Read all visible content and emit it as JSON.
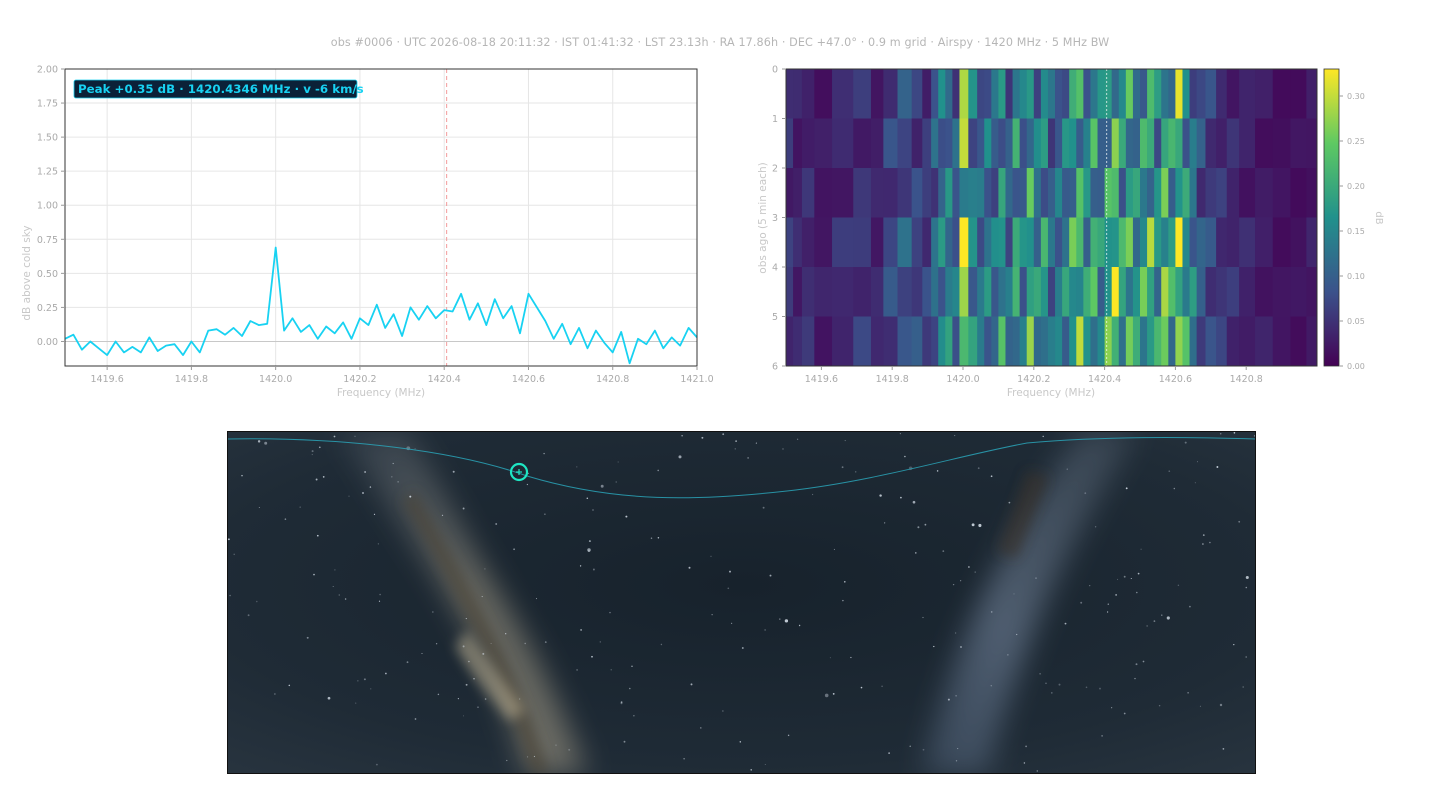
{
  "header": {
    "text": "obs #0006  ·  UTC 2026-08-18 20:11:32  ·  IST 01:41:32  ·  LST 23.13h  ·  RA 17.86h  ·  DEC +47.0°  ·  0.9 m grid · Airspy · 1420 MHz · 5 MHz BW"
  },
  "spectrum": {
    "annotation": "Peak +0.35 dB · 1420.4346 MHz · v -6 km/s"
  },
  "chart_data": [
    {
      "type": "line",
      "xlabel": "Frequency (MHz)",
      "ylabel": "dB above cold sky",
      "xlim": [
        1419.5,
        1421.0
      ],
      "ylim": [
        -0.18,
        2.0
      ],
      "xticks": [
        1419.6,
        1419.8,
        1420.0,
        1420.2,
        1420.4,
        1420.6,
        1420.8,
        1421.0
      ],
      "yticks": [
        0.0,
        0.25,
        0.5,
        0.75,
        1.0,
        1.25,
        1.5,
        1.75,
        2.0
      ],
      "grid": true,
      "reference_line_x": 1420.4058,
      "line_color": "#18d2f2",
      "series": [
        {
          "x": [
            1419.5,
            1419.52,
            1419.54,
            1419.56,
            1419.58,
            1419.6,
            1419.62,
            1419.64,
            1419.66,
            1419.68,
            1419.7,
            1419.72,
            1419.74,
            1419.76,
            1419.78,
            1419.8,
            1419.82,
            1419.84,
            1419.86,
            1419.88,
            1419.9,
            1419.92,
            1419.94,
            1419.96,
            1419.98,
            1420.0,
            1420.02,
            1420.04,
            1420.06,
            1420.08,
            1420.1,
            1420.12,
            1420.14,
            1420.16,
            1420.18,
            1420.2,
            1420.22,
            1420.24,
            1420.26,
            1420.28,
            1420.3,
            1420.32,
            1420.34,
            1420.36,
            1420.38,
            1420.4,
            1420.42,
            1420.44,
            1420.46,
            1420.48,
            1420.5,
            1420.52,
            1420.54,
            1420.56,
            1420.58,
            1420.6,
            1420.62,
            1420.64,
            1420.66,
            1420.68,
            1420.7,
            1420.72,
            1420.74,
            1420.76,
            1420.78,
            1420.8,
            1420.82,
            1420.84,
            1420.86,
            1420.88,
            1420.9,
            1420.92,
            1420.94,
            1420.96,
            1420.98,
            1421.0
          ],
          "values": [
            0.02,
            0.05,
            -0.06,
            0.0,
            -0.05,
            -0.1,
            0.0,
            -0.08,
            -0.04,
            -0.08,
            0.03,
            -0.07,
            -0.03,
            -0.02,
            -0.1,
            0.0,
            -0.08,
            0.08,
            0.09,
            0.05,
            0.1,
            0.04,
            0.15,
            0.12,
            0.13,
            0.69,
            0.08,
            0.17,
            0.07,
            0.12,
            0.02,
            0.11,
            0.06,
            0.14,
            0.02,
            0.17,
            0.12,
            0.27,
            0.1,
            0.2,
            0.04,
            0.25,
            0.16,
            0.26,
            0.17,
            0.23,
            0.22,
            0.35,
            0.16,
            0.28,
            0.12,
            0.31,
            0.17,
            0.26,
            0.06,
            0.35,
            0.25,
            0.15,
            0.02,
            0.13,
            -0.02,
            0.1,
            -0.05,
            0.08,
            -0.01,
            -0.08,
            0.07,
            -0.16,
            0.02,
            -0.02,
            0.08,
            -0.05,
            0.03,
            -0.03,
            0.1,
            0.03
          ]
        }
      ]
    },
    {
      "type": "heatmap",
      "xlabel": "Frequency (MHz)",
      "ylabel": "obs ago (5 min each)",
      "xlim": [
        1419.5,
        1421.0
      ],
      "ylim": [
        0,
        6
      ],
      "xticks": [
        1419.6,
        1419.8,
        1420.0,
        1420.2,
        1420.4,
        1420.6,
        1420.8
      ],
      "yticks": [
        0,
        1,
        2,
        3,
        4,
        5,
        6
      ],
      "colorbar_label": "dB",
      "colorbar_range": [
        0.0,
        0.33
      ],
      "colorbar_ticks": [
        0.0,
        0.05,
        0.1,
        0.15,
        0.2,
        0.25,
        0.3
      ],
      "colormap": "viridis",
      "reference_line_x": 1420.4058,
      "channels": [
        {
          "f": 1419.51,
          "v": 0.06
        },
        {
          "f": 1419.53,
          "v": 0.04
        },
        {
          "f": 1419.56,
          "v": 0.05
        },
        {
          "f": 1419.6,
          "v": 0.03
        },
        {
          "f": 1419.66,
          "v": 0.05
        },
        {
          "f": 1419.72,
          "v": 0.06
        },
        {
          "f": 1419.76,
          "v": 0.04
        },
        {
          "f": 1419.79,
          "v": 0.08
        },
        {
          "f": 1419.84,
          "v": 0.1
        },
        {
          "f": 1419.87,
          "v": 0.08
        },
        {
          "f": 1419.9,
          "v": 0.07
        },
        {
          "f": 1419.92,
          "v": 0.12
        },
        {
          "f": 1419.94,
          "v": 0.15
        },
        {
          "f": 1419.96,
          "v": 0.16
        },
        {
          "f": 1419.98,
          "v": 0.12
        },
        {
          "f": 1420.0,
          "v": 0.33
        },
        {
          "f": 1420.03,
          "v": 0.16
        },
        {
          "f": 1420.05,
          "v": 0.13
        },
        {
          "f": 1420.07,
          "v": 0.15
        },
        {
          "f": 1420.09,
          "v": 0.13
        },
        {
          "f": 1420.11,
          "v": 0.19
        },
        {
          "f": 1420.13,
          "v": 0.12
        },
        {
          "f": 1420.15,
          "v": 0.2
        },
        {
          "f": 1420.17,
          "v": 0.14
        },
        {
          "f": 1420.19,
          "v": 0.23
        },
        {
          "f": 1420.21,
          "v": 0.16
        },
        {
          "f": 1420.23,
          "v": 0.19
        },
        {
          "f": 1420.25,
          "v": 0.12
        },
        {
          "f": 1420.27,
          "v": 0.14
        },
        {
          "f": 1420.29,
          "v": 0.16
        },
        {
          "f": 1420.31,
          "v": 0.21
        },
        {
          "f": 1420.33,
          "v": 0.24
        },
        {
          "f": 1420.35,
          "v": 0.18
        },
        {
          "f": 1420.37,
          "v": 0.22
        },
        {
          "f": 1420.39,
          "v": 0.16
        },
        {
          "f": 1420.41,
          "v": 0.22
        },
        {
          "f": 1420.43,
          "v": 0.28
        },
        {
          "f": 1420.45,
          "v": 0.2
        },
        {
          "f": 1420.47,
          "v": 0.23
        },
        {
          "f": 1420.49,
          "v": 0.18
        },
        {
          "f": 1420.51,
          "v": 0.21
        },
        {
          "f": 1420.53,
          "v": 0.24
        },
        {
          "f": 1420.55,
          "v": 0.18
        },
        {
          "f": 1420.57,
          "v": 0.26
        },
        {
          "f": 1420.59,
          "v": 0.2
        },
        {
          "f": 1420.61,
          "v": 0.3
        },
        {
          "f": 1420.63,
          "v": 0.19
        },
        {
          "f": 1420.65,
          "v": 0.15
        },
        {
          "f": 1420.67,
          "v": 0.1
        },
        {
          "f": 1420.7,
          "v": 0.08
        },
        {
          "f": 1420.73,
          "v": 0.06
        },
        {
          "f": 1420.76,
          "v": 0.05
        },
        {
          "f": 1420.8,
          "v": 0.04
        },
        {
          "f": 1420.85,
          "v": 0.03
        },
        {
          "f": 1420.9,
          "v": 0.02
        },
        {
          "f": 1420.95,
          "v": 0.02
        },
        {
          "f": 1420.99,
          "v": 0.03
        }
      ]
    }
  ],
  "skymap": {
    "marker_color": "#1ee6c3",
    "path_color": "#2aa5b8",
    "background_color": "#1d2833"
  }
}
